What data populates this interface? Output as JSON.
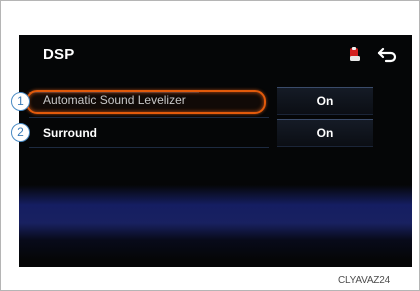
{
  "screen": {
    "title": "DSP",
    "icons": {
      "rear": "rear-seat-icon",
      "back": "back-arrow-icon"
    }
  },
  "rows": [
    {
      "marker": "1",
      "label": "Automatic Sound Levelizer",
      "value": "On",
      "selected": true
    },
    {
      "marker": "2",
      "label": "Surround",
      "value": "On",
      "selected": false
    }
  ],
  "image_code": "CLYAVAZ24",
  "colors": {
    "highlight": "#e25a0b",
    "marker_border": "#4a8bc4",
    "background_glow": "#2837aa"
  }
}
